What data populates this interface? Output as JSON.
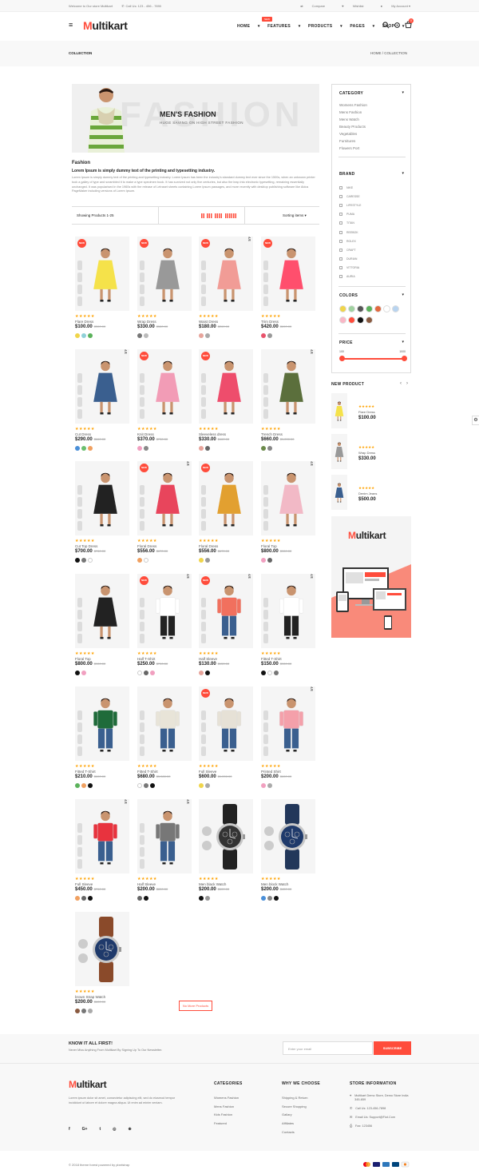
{
  "topbar": {
    "welcome": "Welcome to Our store Multikart",
    "call": "Call Us: 123 - 456 - 7890",
    "compare": "Compare",
    "wishlist": "Wishlist",
    "account": "My Account"
  },
  "header": {
    "logo_m": "M",
    "logo_rest": "ultikart",
    "nav": [
      "HOME",
      "FEATURES",
      "PRODUCTS",
      "PAGES",
      "SHOP"
    ],
    "features_badge": "NEW",
    "cart_count": "0"
  },
  "breadcrumb": {
    "title": "COLLECTION",
    "path": "HOME  /  COLLECTION"
  },
  "banner": {
    "bg_word": "FASHION",
    "title": "MEN'S FASHION",
    "subtitle": "HUGE SAVING ON HIGH STREET FASHION"
  },
  "intro": {
    "heading": "Fashion",
    "subheading": "Lorem Ipsum is simply dummy text of the printing and typesetting industry.",
    "body": "Lorem Ipsum is simply dummy text of the printing and typesetting industry. Lorem Ipsum has been the industry's standard dummy text ever since the 1500s, when an unknown printer took a galley of type and scrambled it to make a type specimen book. It has survived not only five centuries, but also the leap into electronic typesetting, remaining essentially unchanged. It was popularised in the 1960s with the release of Letraset sheets containing Lorem Ipsum passages, and more recently with desktop publishing software like Aldus PageMaker including versions of Lorem Ipsum."
  },
  "toolbar": {
    "showing": "Showing Products 1-25",
    "sorting": "Sorting items"
  },
  "products": [
    {
      "name": "Flare Dress",
      "price": "$100.00",
      "old": "$300.00",
      "badge": "new",
      "colors": [
        "#f0d54a",
        "#8fd0d8",
        "#5bb25b"
      ],
      "dress": "#f5e24a"
    },
    {
      "name": "Wrap Dress",
      "price": "$330.00",
      "old": "$580.00",
      "badge": "new",
      "colors": [
        "#777777",
        "#bbbbbb"
      ],
      "dress": "#999999"
    },
    {
      "name": "Waist Dress",
      "price": "$180.00",
      "old": "$260.00",
      "badge": "new sale",
      "colors": [
        "#e7a49b",
        "#aaaaaa"
      ],
      "dress": "#f19c96"
    },
    {
      "name": "Trim Dress",
      "price": "$420.00",
      "old": "$690.00",
      "badge": "new",
      "colors": [
        "#e8526b",
        "#999999"
      ],
      "dress": "#ff4f6d"
    },
    {
      "name": "Cut Dress",
      "price": "$290.00",
      "old": "$660.00",
      "badge": "sale",
      "colors": [
        "#4a8fd8",
        "#6bbe6e",
        "#f0a060"
      ],
      "dress": "#3a5f8f"
    },
    {
      "name": "Knit Dress",
      "price": "$370.00",
      "old": "$730.00",
      "badge": "new",
      "colors": [
        "#f1a0c0",
        "#888888"
      ],
      "dress": "#f29cb6"
    },
    {
      "name": "Sleeveless dress",
      "price": "$330.00",
      "old": "$460.00",
      "badge": "new",
      "colors": [
        "#e7a49b",
        "#666666"
      ],
      "dress": "#ee4d6c"
    },
    {
      "name": "Trench Dress",
      "price": "$660.00",
      "old": "$1,200.00",
      "badge": "sale",
      "colors": [
        "#6b8a4a",
        "#888888"
      ],
      "dress": "#5b6f3c"
    },
    {
      "name": "Cut Top Dress",
      "price": "$700.00",
      "old": "$760.00",
      "badge": "",
      "colors": [
        "#111111",
        "#777777",
        "#ffffff"
      ],
      "dress": "#222222"
    },
    {
      "name": "Floral Dress",
      "price": "$556.00",
      "old": "$670.00",
      "badge": "new sale",
      "colors": [
        "#f0a060",
        "#ffffff"
      ],
      "dress": "#e8455c"
    },
    {
      "name": "Floral Dress",
      "price": "$556.00",
      "old": "$670.00",
      "badge": "new",
      "colors": [
        "#f0d54a",
        "#999999"
      ],
      "dress": "#e2a030"
    },
    {
      "name": "Floral Top",
      "price": "$800.00",
      "old": "$900.00",
      "badge": "sale",
      "colors": [
        "#f1a0c0",
        "#666666"
      ],
      "dress": "#f2b9c6"
    },
    {
      "name": "Floral Top",
      "price": "$800.00",
      "old": "$900.00",
      "badge": "",
      "colors": [
        "#111111",
        "#f1a0c0"
      ],
      "dress": "#222222"
    },
    {
      "name": "Half T-Shirt",
      "price": "$250.00",
      "old": "$700.00",
      "badge": "new sale",
      "colors": [
        "#ffffff",
        "#666666",
        "#f1a0c0"
      ],
      "dress": "#ffffff"
    },
    {
      "name": "Half Sleeve",
      "price": "$130.00",
      "old": "$150.00",
      "badge": "new sale",
      "colors": [
        "#e7a49b",
        "#111111"
      ],
      "dress": "#f1705e"
    },
    {
      "name": "Fitted T-Shirt",
      "price": "$150.00",
      "old": "$900.00",
      "badge": "sale",
      "colors": [
        "#111111",
        "#ffffff",
        "#777777"
      ],
      "dress": "#ffffff"
    },
    {
      "name": "Fitted T-Shirt",
      "price": "$210.00",
      "old": "$600.00",
      "badge": "",
      "colors": [
        "#5bb25b",
        "#f0a060",
        "#111111"
      ],
      "dress": "#1f6b3a"
    },
    {
      "name": "Fitted T-Shirt",
      "price": "$680.00",
      "old": "$5,580.00",
      "badge": "",
      "colors": [
        "#ffffff",
        "#777777",
        "#111111"
      ],
      "dress": "#e8e4d8"
    },
    {
      "name": "Full Sleeve",
      "price": "$600.00",
      "old": "$1,200.00",
      "badge": "new",
      "colors": [
        "#f0d54a",
        "#aaaaaa"
      ],
      "dress": "#e6e1d6"
    },
    {
      "name": "Printed Shirt",
      "price": "$200.00",
      "old": "$600.00",
      "badge": "sale",
      "colors": [
        "#f1a0c0",
        "#aaaaaa"
      ],
      "dress": "#f4a0aa"
    },
    {
      "name": "Full Sleeve",
      "price": "$450.00",
      "old": "$760.00",
      "badge": "sale",
      "colors": [
        "#f0a060",
        "#666666",
        "#111111"
      ],
      "dress": "#e8333e"
    },
    {
      "name": "Half Sleeve",
      "price": "$200.00",
      "old": "$800.00",
      "badge": "sale",
      "colors": [
        "#666666",
        "#111111"
      ],
      "dress": "#777777"
    },
    {
      "name": "Men black Watch",
      "price": "$200.00",
      "old": "$600.00",
      "badge": "",
      "colors": [
        "#111111",
        "#999999"
      ],
      "watch": "#222222",
      "face": "#333333"
    },
    {
      "name": "Men block Watch",
      "price": "$200.00",
      "old": "$400.00",
      "badge": "",
      "colors": [
        "#4a8fd8",
        "#888888",
        "#111111"
      ],
      "watch": "#22375a",
      "face": "#1f3a6b"
    },
    {
      "name": "brown Strap Watch",
      "price": "$200.00",
      "old": "$600.00",
      "badge": "",
      "colors": [
        "#8a5a40",
        "#777777",
        "#aaaaaa"
      ],
      "watch": "#8a4a2a",
      "face": "#1f3a6b"
    }
  ],
  "labels": {
    "new": "NEW",
    "sale": "ON SALE",
    "stars": "★★★★★"
  },
  "no_more": "No More Products",
  "sidebar": {
    "category_title": "CATEGORY",
    "categories": [
      "Womens Fashion",
      "Mens Fashion",
      "Mens Watch",
      "Beauty Products",
      "Vegetables",
      "Furnitures",
      "Flowers Port"
    ],
    "brand_title": "BRAND",
    "brands": [
      "NIKE",
      "CARESSE",
      "LIFESTYLE",
      "PUMA",
      "TITAN",
      "REEBOK",
      "ROLEX",
      "CRAFT",
      "DURIAN",
      "VITTORIA",
      "AURIA"
    ],
    "colors_title": "COLORS",
    "colors": [
      "#f0d54a",
      "#a0d2a0",
      "#555555",
      "#5bb25b",
      "#e2683e",
      "#ffffff",
      "#b8d4f0",
      "#f9b7c6",
      "#ff4c3b",
      "#111111",
      "#8a5a40"
    ],
    "price_title": "PRICE",
    "price_min": "100",
    "price_max": "1000"
  },
  "new_product": {
    "title": "NEW PRODUCT",
    "items": [
      {
        "name": "Flare Dress",
        "price": "$100.00",
        "dress": "#f5e24a"
      },
      {
        "name": "Wrap Dress",
        "price": "$330.00",
        "dress": "#999999"
      },
      {
        "name": "Denim Jeans",
        "price": "$500.00",
        "dress": "#3a5f8f"
      }
    ]
  },
  "promo": {
    "logo_m": "M",
    "logo_rest": "ultikart"
  },
  "newsletter": {
    "title": "KNOW IT ALL FIRST!",
    "subtitle": "Never Miss Anything From Multikart By Signing Up To Our Newsletter.",
    "placeholder": "Enter your email",
    "button": "SUBSCRIBE"
  },
  "footer": {
    "about": "Lorem ipsum dolor sit amet, consectetur adipiscing elit, sed do eiusmod tempor incididunt ut labore et dolore magna aliqua. Ut enim ad minim veniam.",
    "social": [
      "f",
      "G+",
      "t",
      "◎",
      "⊕"
    ],
    "categories_title": "CATEGORIES",
    "categories": [
      "Womens Fashion",
      "Mens Fashion",
      "Kids Fashion",
      "Featured"
    ],
    "why_title": "WHY WE CHOOSE",
    "why": [
      "Shipping & Return",
      "Secure Shopping",
      "Gallary",
      "Affiliates",
      "Contacts"
    ],
    "store_title": "STORE INFORMATION",
    "store": [
      "Multikart Demo Store, Demo Store India 345-659",
      "Call Us: 123-456-7898",
      "Email Us: Support@Fiot.Com",
      "Fax: 123456"
    ],
    "copyright": "© 2018 theme forest powered by pixelstrap"
  }
}
